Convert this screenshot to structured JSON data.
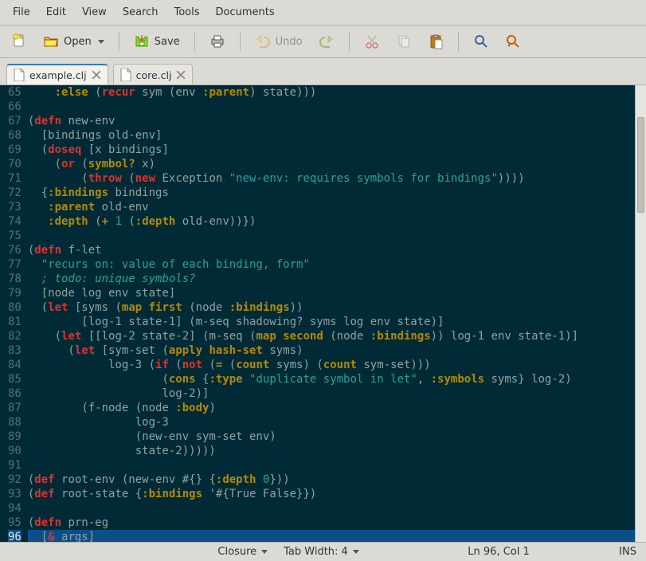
{
  "menu": {
    "items": [
      "File",
      "Edit",
      "View",
      "Search",
      "Tools",
      "Documents"
    ]
  },
  "toolbar": {
    "new": "New",
    "open": "Open",
    "save": "Save",
    "print": "Print",
    "undo": "Undo",
    "redo": "Redo",
    "cut": "Cut",
    "copy": "Copy",
    "paste": "Paste",
    "find": "Find",
    "replace": "Replace"
  },
  "tabs": [
    {
      "label": "example.clj",
      "active": true
    },
    {
      "label": "core.clj",
      "active": false
    }
  ],
  "status": {
    "syntax": "Closure",
    "tab_label": "Tab Width:",
    "tab_width": "4",
    "position": "Ln 96, Col 1",
    "mode": "INS"
  },
  "editor": {
    "first_line": 65,
    "current_line": 96,
    "lines": [
      {
        "n": 65,
        "seg": [
          [
            "",
            "    "
          ],
          [
            "kwd",
            ":else"
          ],
          [
            "",
            " ("
          ],
          [
            "kw",
            "recur"
          ],
          [
            "",
            " sym (env "
          ],
          [
            "kwd",
            ":parent"
          ],
          [
            "",
            ") state)))"
          ]
        ]
      },
      {
        "n": 66,
        "seg": [
          [
            "",
            ""
          ]
        ]
      },
      {
        "n": 67,
        "seg": [
          [
            "",
            "("
          ],
          [
            "kw",
            "defn"
          ],
          [
            "",
            " new-env"
          ]
        ]
      },
      {
        "n": 68,
        "seg": [
          [
            "",
            "  [bindings old-env]"
          ]
        ]
      },
      {
        "n": 69,
        "seg": [
          [
            "",
            "  ("
          ],
          [
            "kw",
            "doseq"
          ],
          [
            "",
            " [x bindings]"
          ]
        ]
      },
      {
        "n": 70,
        "seg": [
          [
            "",
            "    ("
          ],
          [
            "kw",
            "or"
          ],
          [
            "",
            " ("
          ],
          [
            "fn",
            "symbol?"
          ],
          [
            "",
            " x)"
          ]
        ]
      },
      {
        "n": 71,
        "seg": [
          [
            "",
            "        ("
          ],
          [
            "kw",
            "throw"
          ],
          [
            "",
            " ("
          ],
          [
            "kw",
            "new"
          ],
          [
            "",
            " Exception "
          ],
          [
            "str",
            "\"new-env: requires symbols for bindings\""
          ],
          [
            "",
            "))))"
          ]
        ]
      },
      {
        "n": 72,
        "seg": [
          [
            "",
            "  {"
          ],
          [
            "kwd",
            ":bindings"
          ],
          [
            "",
            " bindings"
          ]
        ]
      },
      {
        "n": 73,
        "seg": [
          [
            "",
            "   "
          ],
          [
            "kwd",
            ":parent"
          ],
          [
            "",
            " old-env"
          ]
        ]
      },
      {
        "n": 74,
        "seg": [
          [
            "",
            "   "
          ],
          [
            "kwd",
            ":depth"
          ],
          [
            "",
            " ("
          ],
          [
            "fn",
            "+"
          ],
          [
            "",
            " "
          ],
          [
            "num",
            "1"
          ],
          [
            "",
            " ("
          ],
          [
            "kwd",
            ":depth"
          ],
          [
            "",
            " old-env))})"
          ]
        ]
      },
      {
        "n": 75,
        "seg": [
          [
            "",
            ""
          ]
        ]
      },
      {
        "n": 76,
        "seg": [
          [
            "",
            "("
          ],
          [
            "kw",
            "defn"
          ],
          [
            "",
            " f-let"
          ]
        ]
      },
      {
        "n": 77,
        "seg": [
          [
            "",
            "  "
          ],
          [
            "str",
            "\"recurs on: value of each binding, form\""
          ]
        ]
      },
      {
        "n": 78,
        "seg": [
          [
            "",
            "  "
          ],
          [
            "cmt",
            "; todo: unique symbols?"
          ]
        ]
      },
      {
        "n": 79,
        "seg": [
          [
            "",
            "  [node log env state]"
          ]
        ]
      },
      {
        "n": 80,
        "seg": [
          [
            "",
            "  ("
          ],
          [
            "kw",
            "let"
          ],
          [
            "",
            " [syms ("
          ],
          [
            "fn",
            "map"
          ],
          [
            "",
            " "
          ],
          [
            "fn",
            "first"
          ],
          [
            "",
            " (node "
          ],
          [
            "kwd",
            ":bindings"
          ],
          [
            "",
            "))"
          ]
        ]
      },
      {
        "n": 81,
        "seg": [
          [
            "",
            "        [log-1 state-1] (m-seq shadowing? syms log env state)]"
          ]
        ]
      },
      {
        "n": 82,
        "seg": [
          [
            "",
            "    ("
          ],
          [
            "kw",
            "let"
          ],
          [
            "",
            " [[log-2 state-2] (m-seq ("
          ],
          [
            "fn",
            "map"
          ],
          [
            "",
            " "
          ],
          [
            "fn",
            "second"
          ],
          [
            "",
            " (node "
          ],
          [
            "kwd",
            ":bindings"
          ],
          [
            "",
            ")) log-1 env state-1)]"
          ]
        ]
      },
      {
        "n": 83,
        "seg": [
          [
            "",
            "      ("
          ],
          [
            "kw",
            "let"
          ],
          [
            "",
            " [sym-set ("
          ],
          [
            "fn",
            "apply"
          ],
          [
            "",
            " "
          ],
          [
            "fn",
            "hash-set"
          ],
          [
            "",
            " syms)"
          ]
        ]
      },
      {
        "n": 84,
        "seg": [
          [
            "",
            "            log-3 ("
          ],
          [
            "kw",
            "if"
          ],
          [
            "",
            " ("
          ],
          [
            "kw",
            "not"
          ],
          [
            "",
            " ("
          ],
          [
            "fn",
            "="
          ],
          [
            "",
            " ("
          ],
          [
            "fn",
            "count"
          ],
          [
            "",
            " syms) ("
          ],
          [
            "fn",
            "count"
          ],
          [
            "",
            " sym-set)))"
          ]
        ]
      },
      {
        "n": 85,
        "seg": [
          [
            "",
            "                    ("
          ],
          [
            "fn",
            "cons"
          ],
          [
            "",
            " {"
          ],
          [
            "kwd",
            ":type"
          ],
          [
            "",
            " "
          ],
          [
            "str",
            "\"duplicate symbol in let\""
          ],
          [
            "",
            ", "
          ],
          [
            "kwd",
            ":symbols"
          ],
          [
            "",
            " syms} log-2)"
          ]
        ]
      },
      {
        "n": 86,
        "seg": [
          [
            "",
            "                    log-2)]"
          ]
        ]
      },
      {
        "n": 87,
        "seg": [
          [
            "",
            "        (f-node (node "
          ],
          [
            "kwd",
            ":body"
          ],
          [
            "",
            ")"
          ]
        ]
      },
      {
        "n": 88,
        "seg": [
          [
            "",
            "                log-3"
          ]
        ]
      },
      {
        "n": 89,
        "seg": [
          [
            "",
            "                (new-env sym-set env)"
          ]
        ]
      },
      {
        "n": 90,
        "seg": [
          [
            "",
            "                state-2)))))"
          ]
        ]
      },
      {
        "n": 91,
        "seg": [
          [
            "",
            ""
          ]
        ]
      },
      {
        "n": 92,
        "seg": [
          [
            "",
            "("
          ],
          [
            "kw",
            "def"
          ],
          [
            "",
            " root-env (new-env #{} {"
          ],
          [
            "kwd",
            ":depth"
          ],
          [
            "",
            " "
          ],
          [
            "num",
            "0"
          ],
          [
            "",
            "}))"
          ]
        ]
      },
      {
        "n": 93,
        "seg": [
          [
            "",
            "("
          ],
          [
            "kw",
            "def"
          ],
          [
            "",
            " root-state {"
          ],
          [
            "kwd",
            ":bindings"
          ],
          [
            "",
            " '#{True False}})"
          ]
        ]
      },
      {
        "n": 94,
        "seg": [
          [
            "",
            ""
          ]
        ]
      },
      {
        "n": 95,
        "seg": [
          [
            "",
            "("
          ],
          [
            "kw",
            "defn"
          ],
          [
            "",
            " prn-eg"
          ]
        ]
      },
      {
        "n": 96,
        "seg": [
          [
            "",
            "  ["
          ],
          [
            "amp",
            "&"
          ],
          [
            "",
            " args]"
          ]
        ]
      }
    ]
  }
}
